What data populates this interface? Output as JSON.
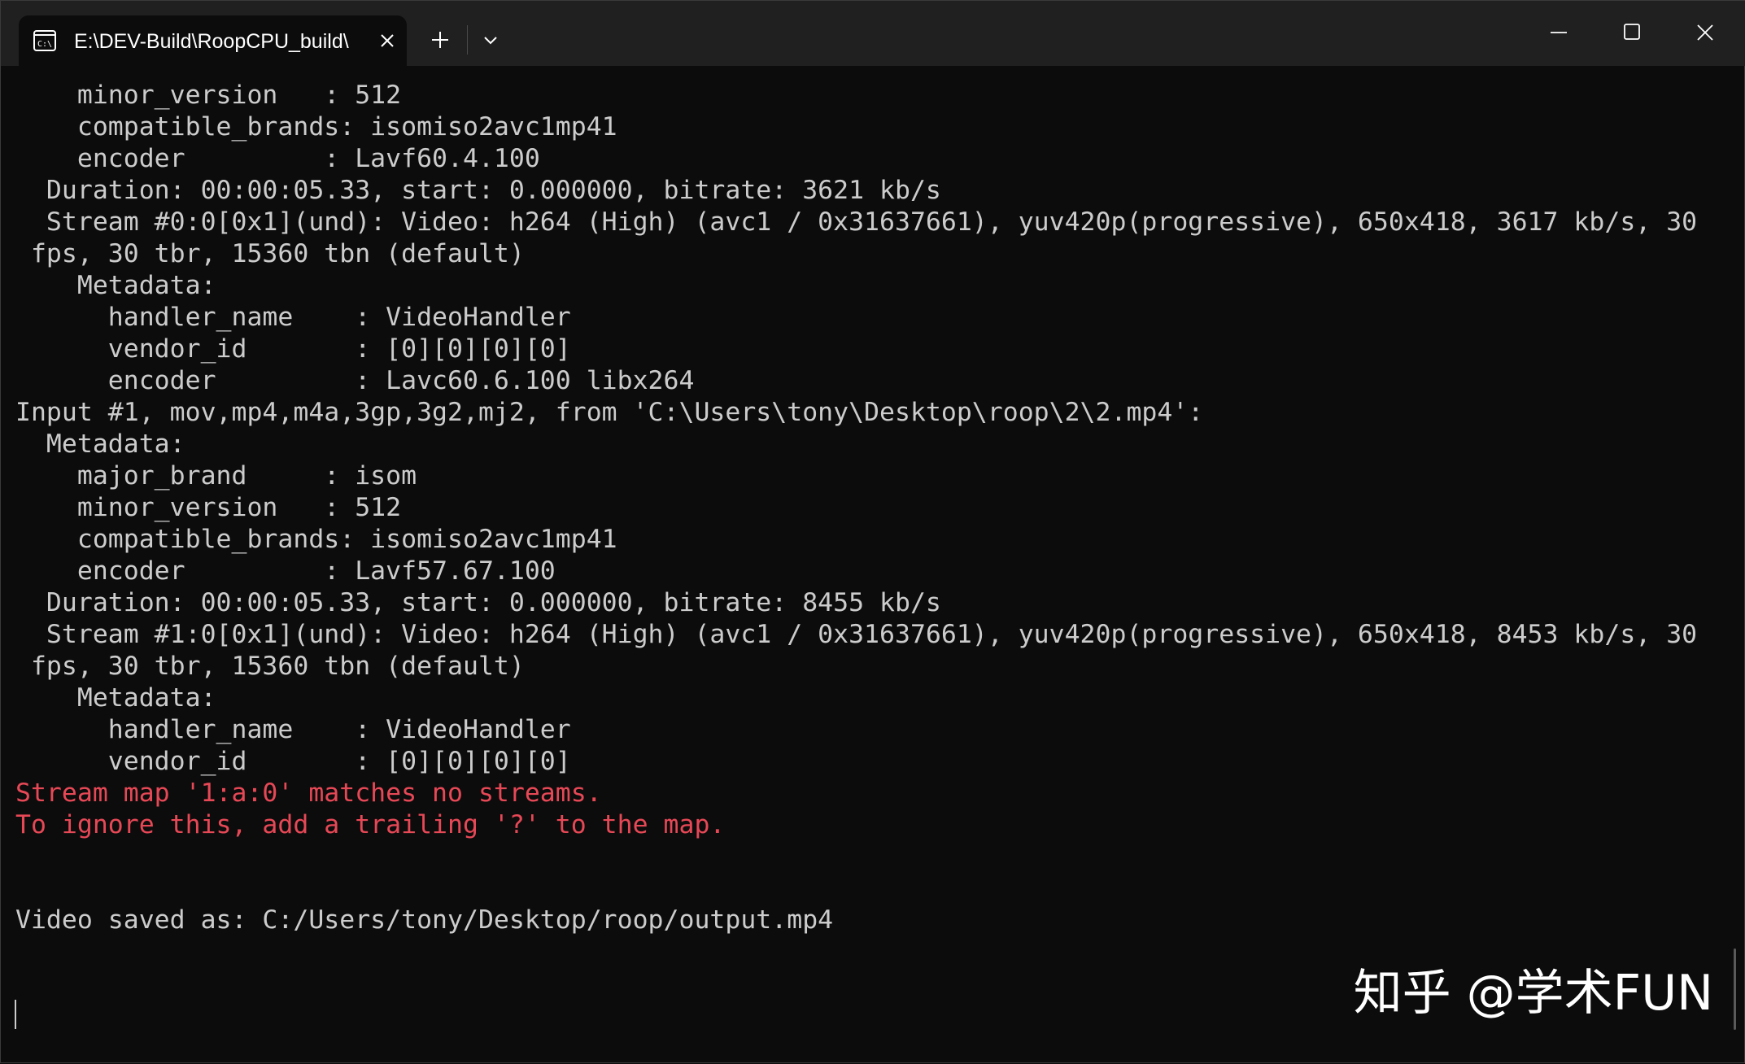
{
  "titlebar": {
    "tab_title": "E:\\DEV-Build\\RoopCPU_build\\",
    "tab_icon": "cmd-icon",
    "close_tab_icon": "close-icon",
    "new_tab_icon": "plus-icon",
    "dropdown_icon": "chevron-down-icon",
    "window_controls": [
      "minimize-icon",
      "maximize-icon",
      "close-icon"
    ]
  },
  "terminal": {
    "lines": [
      {
        "text": "    minor_version   : 512",
        "style": "normal"
      },
      {
        "text": "    compatible_brands: isomiso2avc1mp41",
        "style": "normal"
      },
      {
        "text": "    encoder         : Lavf60.4.100",
        "style": "normal"
      },
      {
        "text": "  Duration: 00:00:05.33, start: 0.000000, bitrate: 3621 kb/s",
        "style": "normal"
      },
      {
        "text": "  Stream #0:0[0x1](und): Video: h264 (High) (avc1 / 0x31637661), yuv420p(progressive), 650x418, 3617 kb/s, 30",
        "style": "normal"
      },
      {
        "text": " fps, 30 tbr, 15360 tbn (default)",
        "style": "normal"
      },
      {
        "text": "    Metadata:",
        "style": "normal"
      },
      {
        "text": "      handler_name    : VideoHandler",
        "style": "normal"
      },
      {
        "text": "      vendor_id       : [0][0][0][0]",
        "style": "normal"
      },
      {
        "text": "      encoder         : Lavc60.6.100 libx264",
        "style": "normal"
      },
      {
        "text": "Input #1, mov,mp4,m4a,3gp,3g2,mj2, from 'C:\\Users\\tony\\Desktop\\roop\\2\\2.mp4':",
        "style": "normal"
      },
      {
        "text": "  Metadata:",
        "style": "normal"
      },
      {
        "text": "    major_brand     : isom",
        "style": "normal"
      },
      {
        "text": "    minor_version   : 512",
        "style": "normal"
      },
      {
        "text": "    compatible_brands: isomiso2avc1mp41",
        "style": "normal"
      },
      {
        "text": "    encoder         : Lavf57.67.100",
        "style": "normal"
      },
      {
        "text": "  Duration: 00:00:05.33, start: 0.000000, bitrate: 8455 kb/s",
        "style": "normal"
      },
      {
        "text": "  Stream #1:0[0x1](und): Video: h264 (High) (avc1 / 0x31637661), yuv420p(progressive), 650x418, 8453 kb/s, 30",
        "style": "normal"
      },
      {
        "text": " fps, 30 tbr, 15360 tbn (default)",
        "style": "normal"
      },
      {
        "text": "    Metadata:",
        "style": "normal"
      },
      {
        "text": "      handler_name    : VideoHandler",
        "style": "normal"
      },
      {
        "text": "      vendor_id       : [0][0][0][0]",
        "style": "normal"
      },
      {
        "text": "Stream map '1:a:0' matches no streams.",
        "style": "error"
      },
      {
        "text": "To ignore this, add a trailing '?' to the map.",
        "style": "error"
      },
      {
        "text": "",
        "style": "normal"
      },
      {
        "text": "",
        "style": "normal"
      },
      {
        "text": "Video saved as: C:/Users/tony/Desktop/roop/output.mp4",
        "style": "normal"
      }
    ]
  },
  "watermark": {
    "text": "知乎 @学术FUN"
  },
  "colors": {
    "background": "#0c0c0c",
    "titlebar": "#202020",
    "foreground": "#cccccc",
    "error": "#e74856"
  }
}
